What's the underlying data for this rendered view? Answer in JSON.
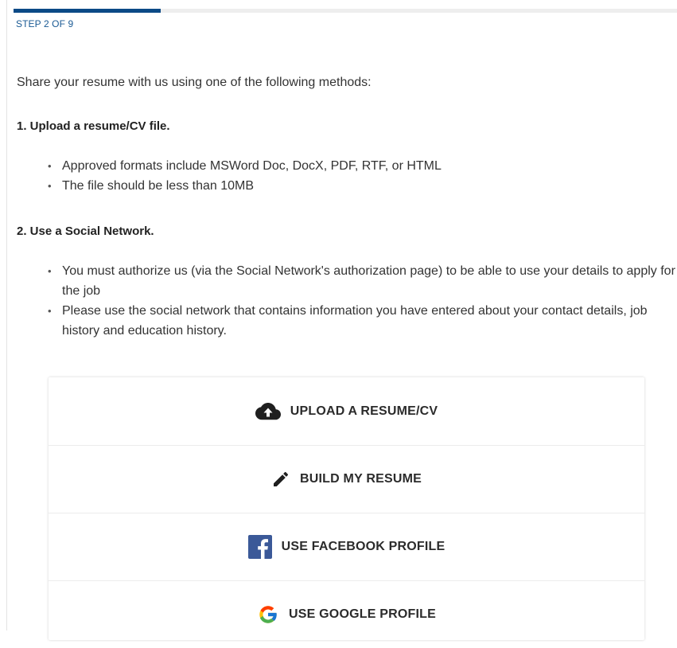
{
  "progress": {
    "step_text": "STEP 2 OF 9",
    "fraction": 0.2222,
    "fill_color": "#0b4a86"
  },
  "intro": "Share your resume with us using one of the following methods:",
  "sections": [
    {
      "heading": "1. Upload a resume/CV file.",
      "bullets": [
        "Approved formats include MSWord Doc, DocX, PDF, RTF, or HTML",
        "The file should be less than 10MB"
      ]
    },
    {
      "heading": "2. Use a Social Network.",
      "bullets": [
        "You must authorize us (via the Social Network's authorization page) to be able to use your details to apply for the job",
        "Please use the social network that contains information you have entered about your contact details, job history and education history."
      ]
    }
  ],
  "options": [
    {
      "label": "UPLOAD A RESUME/CV",
      "icon": "cloud-upload-icon"
    },
    {
      "label": "BUILD MY RESUME",
      "icon": "pencil-icon"
    },
    {
      "label": "USE FACEBOOK PROFILE",
      "icon": "facebook-icon",
      "color": "#3b5998"
    },
    {
      "label": "USE GOOGLE PROFILE",
      "icon": "google-icon"
    }
  ]
}
